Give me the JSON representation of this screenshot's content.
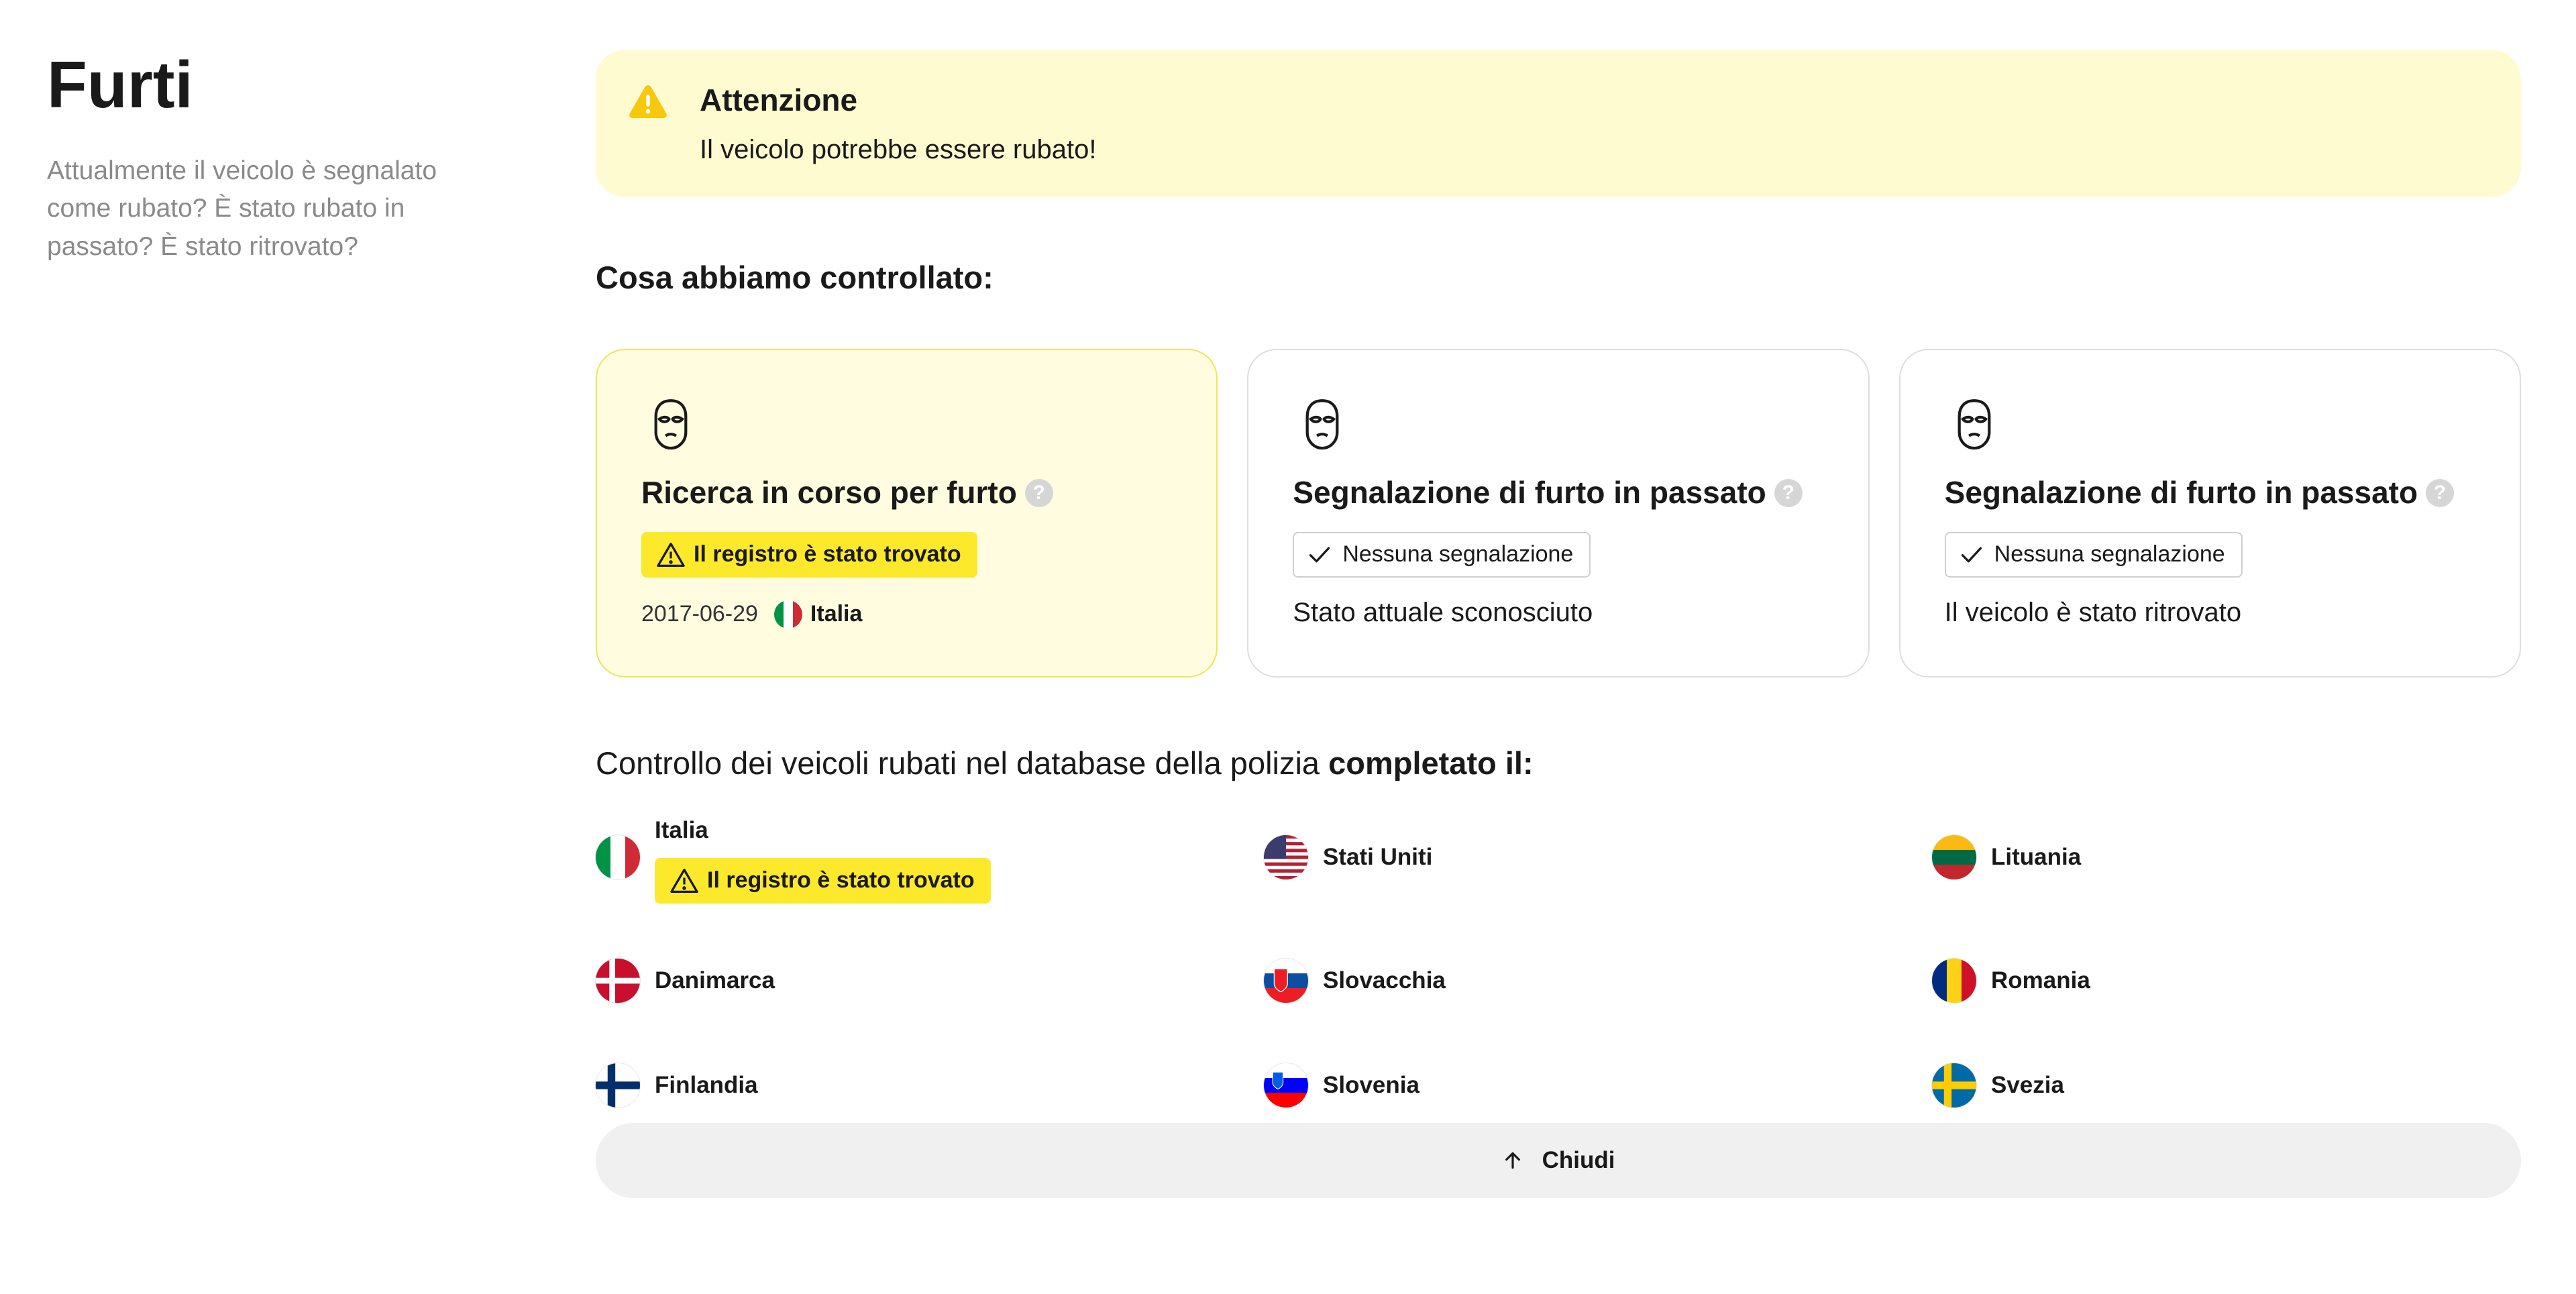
{
  "section": {
    "title": "Furti",
    "subtitle": "Attualmente il veicolo è segnalato come rubato? È stato rubato in passato? È stato ritrovato?"
  },
  "alert": {
    "title": "Attenzione",
    "text": "Il veicolo potrebbe essere rubato!",
    "color": "#fffbd1"
  },
  "checked_heading": "Cosa abbiamo controllato:",
  "cards": [
    {
      "title": "Ricerca in corso per furto",
      "help": "?",
      "badge": "Il registro è stato trovato",
      "date": "2017-06-29",
      "country": "Italia",
      "icon": "balaclava-icon"
    },
    {
      "title": "Segnalazione di furto in passato",
      "help": "?",
      "badge": "Nessuna segnalazione",
      "status": "Stato attuale sconosciuto",
      "icon": "balaclava-icon"
    },
    {
      "title": "Segnalazione di furto in passato",
      "help": "?",
      "badge": "Nessuna segnalazione",
      "status": "Il veicolo è stato ritrovato",
      "icon": "balaclava-icon"
    }
  ],
  "database": {
    "text": "Controllo dei veicoli rubati nel database della polizia ",
    "bold": "completato il:"
  },
  "countries": [
    {
      "name": "Italia",
      "badge": "Il registro è stato trovato"
    },
    {
      "name": "Stati Uniti"
    },
    {
      "name": "Lituania"
    },
    {
      "name": "Danimarca"
    },
    {
      "name": "Slovacchia"
    },
    {
      "name": "Romania"
    },
    {
      "name": "Finlandia"
    },
    {
      "name": "Slovenia"
    },
    {
      "name": "Svezia"
    }
  ],
  "close_label": "Chiudi",
  "colors": {
    "warning_yellow": "#fde92c",
    "card_warn_bg": "#fffce0",
    "button_bg": "#f0f0f0"
  }
}
